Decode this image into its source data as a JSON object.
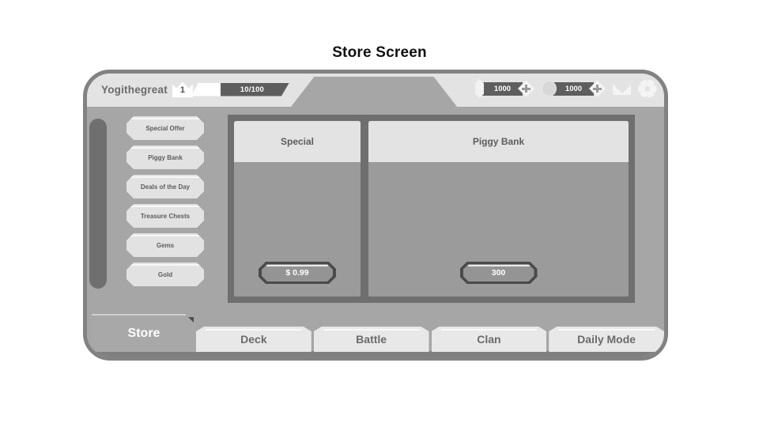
{
  "title": "Store Screen",
  "topbar": {
    "player_name": "Yogithegreat",
    "level": "1",
    "xp_text": "10/100",
    "currencies": [
      {
        "icon": "gem-icon",
        "amount": "1000",
        "plus_label": "+"
      },
      {
        "icon": "coin-icon",
        "amount": "1000",
        "plus_label": "+"
      }
    ],
    "mail_icon": "mail-icon",
    "settings_icon": "gear-icon"
  },
  "sidebar": {
    "items": [
      {
        "label": "Special Offer"
      },
      {
        "label": "Piggy Bank"
      },
      {
        "label": "Deals of the Day"
      },
      {
        "label": "Treasure Chests"
      },
      {
        "label": "Gems"
      },
      {
        "label": "Gold"
      }
    ]
  },
  "store": {
    "cards": [
      {
        "title": "Special",
        "price": "$ 0.99"
      },
      {
        "title": "Piggy Bank",
        "price": "300"
      }
    ]
  },
  "navbar": {
    "active": "Store",
    "items": [
      {
        "label": "Deck"
      },
      {
        "label": "Battle"
      },
      {
        "label": "Clan"
      },
      {
        "label": "Daily Mode"
      }
    ]
  },
  "colors": {
    "frame_border": "#828282",
    "topbar_bg": "#e3e3e3",
    "body_bg": "#a6a6a6",
    "panel_bg": "#6f6f6f",
    "card_bg": "#9b9b9b",
    "button_light": "#e2e2e2",
    "text_gray": "#5c5c5c"
  }
}
